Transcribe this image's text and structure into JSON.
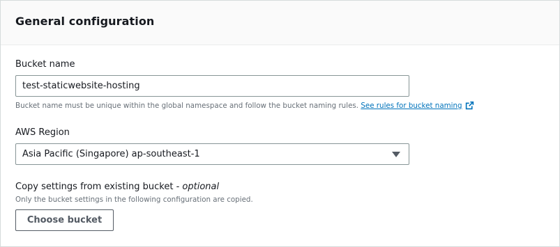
{
  "panel": {
    "title": "General configuration"
  },
  "bucket_name": {
    "label": "Bucket name",
    "value": "test-staticwebsite-hosting",
    "hint": "Bucket name must be unique within the global namespace and follow the bucket naming rules.",
    "link_text": "See rules for bucket naming",
    "link_icon": "external-link-icon"
  },
  "region": {
    "label": "AWS Region",
    "selected": "Asia Pacific (Singapore) ap-southeast-1",
    "caret_icon": "caret-down-icon"
  },
  "copy_settings": {
    "label": "Copy settings from existing bucket - ",
    "optional": "optional",
    "hint": "Only the bucket settings in the following configuration are copied.",
    "button": "Choose bucket"
  },
  "colors": {
    "link": "#0073bb",
    "border": "#879596",
    "header_bg": "#fafafa"
  }
}
